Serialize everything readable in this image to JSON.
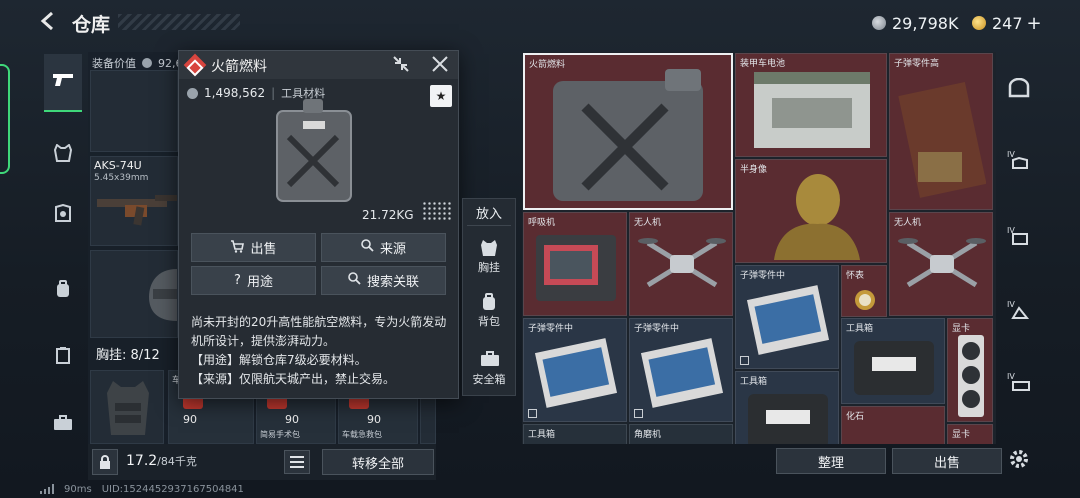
{
  "header": {
    "title": "仓库",
    "currency_main": "29,798K",
    "currency_secondary": "247",
    "add_label": "+"
  },
  "equipment": {
    "value_label": "装备价值",
    "value_amount": "92,6",
    "weapon_name": "AKS-74U",
    "weapon_ammo": "5.45x39mm",
    "chest_label": "胸挂:",
    "chest_capacity": "8/12",
    "chest_items": [
      {
        "label": "",
        "count": ""
      },
      {
        "label": "车",
        "count": "90"
      },
      {
        "label": "简易手术包",
        "count": "90"
      },
      {
        "label": "车载急救包",
        "count": "90"
      },
      {
        "label": "",
        "count": "90"
      }
    ],
    "weight_current": "17.2",
    "weight_max": "/84千克",
    "transfer_all": "转移全部"
  },
  "popup": {
    "title": "火箭燃料",
    "price": "1,498,562",
    "category": "工具材料",
    "star": "★",
    "weight": "21.72KG",
    "btn_sell": "出售",
    "btn_source": "来源",
    "btn_usage": "用途",
    "btn_search": "搜索关联",
    "description": "尚未开封的20升高性能航空燃料，专为火箭发动机所设计，提供澎湃动力。",
    "usage_line": "【用途】解锁仓库7级必要材料。",
    "source_line": "【来源】仅限航天城产出，禁止交易。"
  },
  "put_panel": {
    "title": "放入",
    "items": [
      "胸挂",
      "背包",
      "安全箱"
    ]
  },
  "storage": {
    "cells": [
      {
        "label": "火箭燃料",
        "kind": "red"
      },
      {
        "label": "装甲车电池",
        "kind": "red"
      },
      {
        "label": "子弹零件高",
        "kind": "red"
      },
      {
        "label": "半身像",
        "kind": "red"
      },
      {
        "label": "呼吸机",
        "kind": "red"
      },
      {
        "label": "无人机",
        "kind": "red"
      },
      {
        "label": "无人机",
        "kind": "red"
      },
      {
        "label": "子弹零件中",
        "kind": "blue"
      },
      {
        "label": "怀表",
        "kind": "red"
      },
      {
        "label": "子弹零件中",
        "kind": "blue"
      },
      {
        "label": "子弹零件中",
        "kind": "blue"
      },
      {
        "label": "工具箱",
        "kind": "blue"
      },
      {
        "label": "显卡",
        "kind": "red"
      },
      {
        "label": "工具箱",
        "kind": "blue"
      },
      {
        "label": "工具箱",
        "kind": "dark"
      },
      {
        "label": "角磨机",
        "kind": "dark"
      },
      {
        "label": "化石",
        "kind": "red"
      },
      {
        "label": "显卡",
        "kind": "red"
      }
    ],
    "btn_sort": "整理",
    "btn_sell": "出售"
  },
  "status": {
    "ping": "90ms",
    "uid": "UID:1524452937167504841"
  },
  "colors": {
    "accent_green": "#3fd87a",
    "rarity_red": "#5a2c31",
    "rarity_blue": "#2a3646",
    "brand_red": "#d8453f"
  }
}
